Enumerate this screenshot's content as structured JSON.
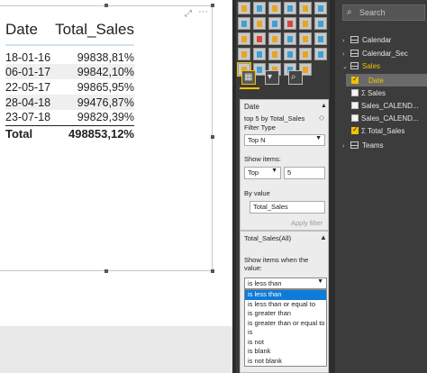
{
  "table": {
    "headers": [
      "Date",
      "Total_Sales"
    ],
    "rows": [
      [
        "18-01-16",
        "99838,81%"
      ],
      [
        "06-01-17",
        "99842,10%"
      ],
      [
        "22-05-17",
        "99865,95%"
      ],
      [
        "28-04-18",
        "99476,87%"
      ],
      [
        "23-07-18",
        "99829,39%"
      ]
    ],
    "total": [
      "Total",
      "498853,12%"
    ]
  },
  "filter": {
    "title": "Date",
    "subtitle": "top 5 by Total_Sales",
    "filter_type_label": "Filter Type",
    "filter_type_value": "Top N",
    "show_items_label": "Show items:",
    "top_select": "Top",
    "top_count": "5",
    "by_value_label": "By value",
    "by_value_field": "Total_Sales",
    "apply_label": "Apply filter"
  },
  "measure_filter": {
    "title": "Total_Sales(All)",
    "show_items_text": "Show items when the value:",
    "selected": "is less than",
    "options": [
      "is less than",
      "is less than or equal to",
      "is greater than",
      "is greater than or equal to",
      "is",
      "is not",
      "is blank",
      "is not blank"
    ]
  },
  "fields": {
    "search_placeholder": "Search",
    "tables": [
      {
        "name": "Calendar",
        "expanded": false
      },
      {
        "name": "Calendar_Sec",
        "expanded": false
      },
      {
        "name": "Sales",
        "expanded": true
      }
    ],
    "sales_fields": [
      {
        "name": "Date",
        "checked": true,
        "measure": false
      },
      {
        "name": "Sales",
        "checked": false,
        "measure": true
      },
      {
        "name": "Sales_CALEND...",
        "checked": false,
        "measure": false
      },
      {
        "name": "Sales_CALEND...",
        "checked": false,
        "measure": false
      },
      {
        "name": "Total_Sales",
        "checked": true,
        "measure": true
      }
    ],
    "other_tables": [
      {
        "name": "Teams",
        "expanded": false
      }
    ]
  },
  "colors": {
    "accent": "#f2c200",
    "dropdown_highlight": "#0f7bd8"
  }
}
